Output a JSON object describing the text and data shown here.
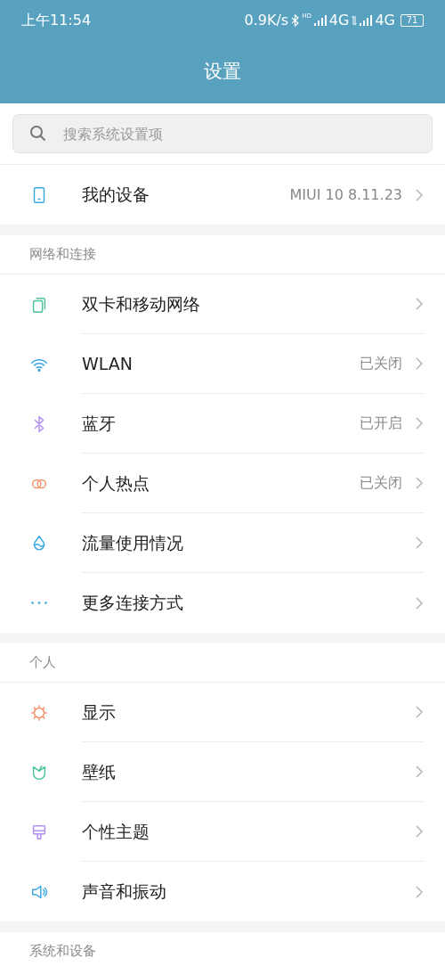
{
  "status_bar": {
    "time": "上午11:54",
    "speed": "0.9K/s",
    "hd": "HD",
    "network_1": "4G",
    "network_2": "4G",
    "battery": "71"
  },
  "title": "设置",
  "search": {
    "placeholder": "搜索系统设置项"
  },
  "device": {
    "label": "我的设备",
    "value": "MIUI 10 8.11.23"
  },
  "sections": [
    {
      "header": "网络和连接",
      "items": [
        {
          "label": "双卡和移动网络"
        },
        {
          "label": "WLAN",
          "value": "已关闭"
        },
        {
          "label": "蓝牙",
          "value": "已开启"
        },
        {
          "label": "个人热点",
          "value": "已关闭"
        },
        {
          "label": "流量使用情况"
        },
        {
          "label": "更多连接方式"
        }
      ]
    },
    {
      "header": "个人",
      "items": [
        {
          "label": "显示"
        },
        {
          "label": "壁纸"
        },
        {
          "label": "个性主题"
        },
        {
          "label": "声音和振动"
        }
      ]
    },
    {
      "header": "系统和设备"
    }
  ]
}
